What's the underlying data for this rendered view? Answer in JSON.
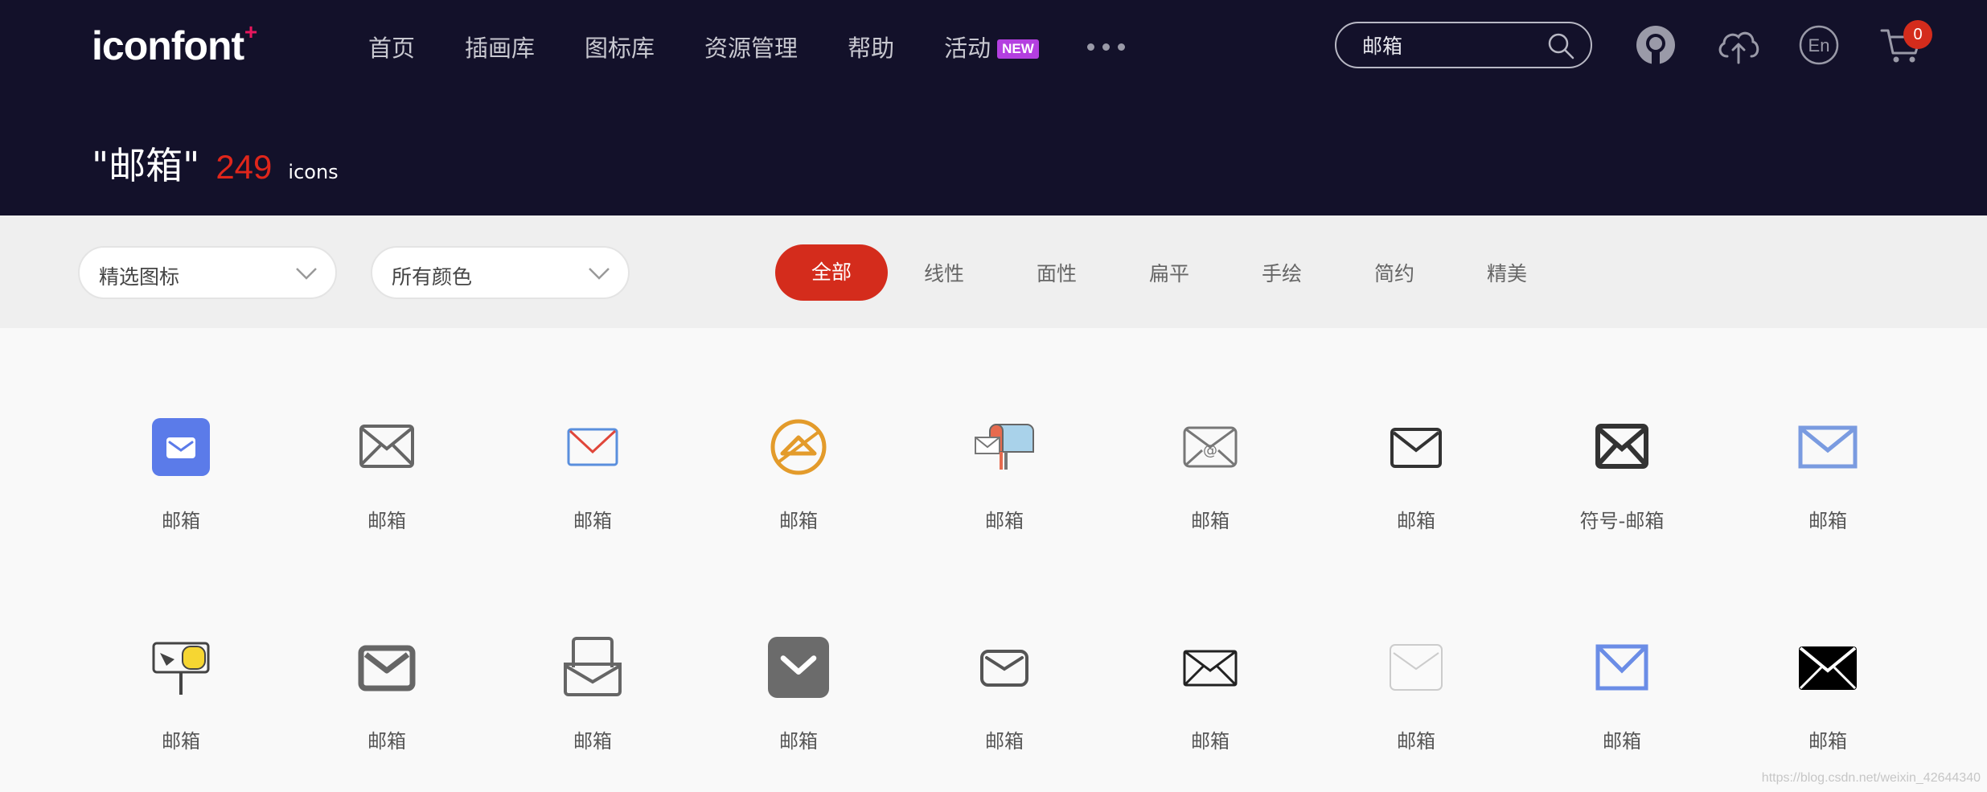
{
  "brand": {
    "logo_text": "iconfont",
    "logo_plus": "+"
  },
  "nav": {
    "items": [
      "首页",
      "插画库",
      "图标库",
      "资源管理",
      "帮助"
    ],
    "activity_label": "活动",
    "activity_badge": "NEW",
    "more_icon": "more-dots-icon"
  },
  "search": {
    "value": "邮箱",
    "icon": "search-icon"
  },
  "header_icons": [
    "github-icon",
    "upload-cloud-icon",
    "language-en-icon",
    "cart-icon"
  ],
  "language_label": "En",
  "cart": {
    "count": "0"
  },
  "result": {
    "query": "\"邮箱\"",
    "count": "249",
    "unit": "icons"
  },
  "filters": {
    "select_1": "精选图标",
    "select_2": "所有颜色",
    "tabs": [
      "全部",
      "线性",
      "面性",
      "扁平",
      "手绘",
      "简约",
      "精美"
    ],
    "active_tab": "全部"
  },
  "colors": {
    "header_bg": "#13112a",
    "accent_red": "#d42c1c",
    "new_badge": "#b43fe0"
  },
  "icons": [
    {
      "label": "邮箱",
      "icon": "mail-blue-square-icon"
    },
    {
      "label": "邮箱",
      "icon": "mail-outline-grey-icon"
    },
    {
      "label": "邮箱",
      "icon": "mail-blue-red-icon"
    },
    {
      "label": "邮箱",
      "icon": "mail-orange-circle-icon"
    },
    {
      "label": "邮箱",
      "icon": "mailbox-colored-icon"
    },
    {
      "label": "邮箱",
      "icon": "mail-at-icon"
    },
    {
      "label": "邮箱",
      "icon": "mail-outline-dark-icon"
    },
    {
      "label": "符号-邮箱",
      "icon": "mail-bold-dark-icon"
    },
    {
      "label": "邮箱",
      "icon": "mail-light-blue-icon"
    },
    {
      "label": "邮箱",
      "icon": "mailbox-yellow-post-icon"
    },
    {
      "label": "邮箱",
      "icon": "mail-thick-grey-icon"
    },
    {
      "label": "邮箱",
      "icon": "mail-tray-icon"
    },
    {
      "label": "邮箱",
      "icon": "mail-grey-filled-icon"
    },
    {
      "label": "邮箱",
      "icon": "mail-small-outline-icon"
    },
    {
      "label": "邮箱",
      "icon": "mail-thin-dark-icon"
    },
    {
      "label": "邮箱",
      "icon": "mail-faint-icon"
    },
    {
      "label": "邮箱",
      "icon": "mail-blue-outline-icon"
    },
    {
      "label": "邮箱",
      "icon": "mail-black-filled-icon"
    }
  ],
  "watermark": "https://blog.csdn.net/weixin_42644340"
}
